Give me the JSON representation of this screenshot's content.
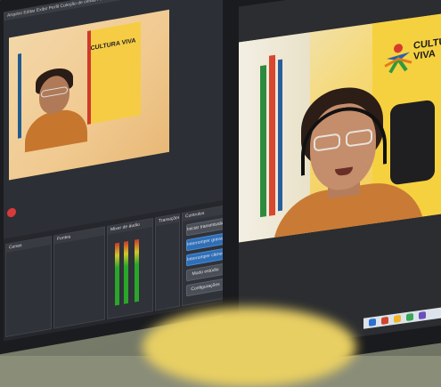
{
  "obs": {
    "menu": "Arquivo  Editar  Exibir  Perfil  Coleção de cenas  Ferramentas  Ajuda",
    "docks": {
      "scenes": "Cenas",
      "sources": "Fontes",
      "mixer": "Mixer de áudio",
      "transitions": "Transições de cena",
      "controls": "Controles"
    },
    "buttons": {
      "start_stream": "Iniciar transmissão",
      "stop_recording": "Interromper gravação",
      "stop_virtual_cam": "Interromper câmera virtual",
      "studio_mode": "Modo estúdio",
      "settings": "Configurações"
    },
    "recording_indicator_color": "#d83a3a",
    "active_button_color": "#2f6fb8"
  },
  "video": {
    "poster_text": "CULTURA VIVA"
  },
  "preview": {
    "poster_text": "CULTURA VIVA"
  }
}
